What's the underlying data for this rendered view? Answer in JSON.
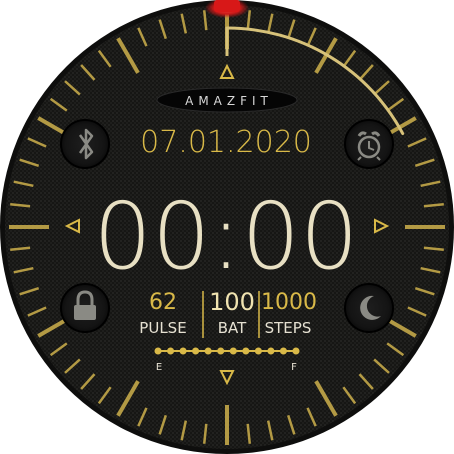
{
  "watchface": {
    "brand": "AMAZFIT",
    "date": "07.01.2020",
    "time": "00:00",
    "stats": {
      "pulse": {
        "value": "62",
        "label": "PULSE"
      },
      "battery": {
        "value": "100",
        "label": "BAT"
      },
      "steps": {
        "value": "1000",
        "label": "STEPS"
      }
    },
    "fuel_gauge": {
      "empty_label": "E",
      "full_label": "F",
      "level": 1.0
    },
    "icons": {
      "top_left": "bluetooth-icon",
      "top_right": "alarm-clock-icon",
      "bottom_left": "lock-icon",
      "bottom_right": "moon-icon"
    },
    "colors": {
      "accent_gold": "#d9b948",
      "tick_gold": "#b39a44",
      "background": "#1a1a17",
      "indicator_red": "#e02020"
    }
  }
}
